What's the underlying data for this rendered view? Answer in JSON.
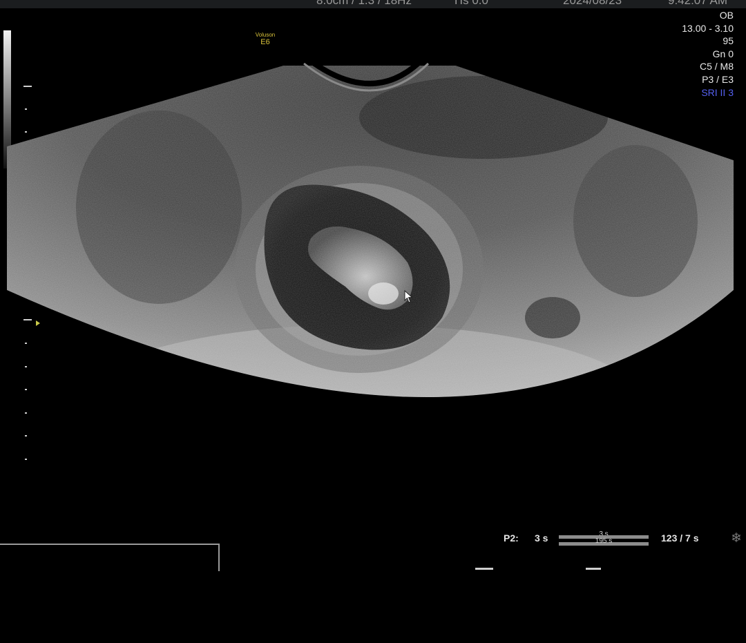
{
  "header": {
    "probe_info": "8.0cm / 1.3 / 18Hz",
    "tis": "TIs 0.0",
    "date": "2024/08/23",
    "time": "9:42:07 AM"
  },
  "brand": {
    "line1": "Voluson",
    "line2": "E6"
  },
  "params": {
    "mode": "OB",
    "freq": "13.00 - 3.10",
    "power": "95",
    "gain": "Gn  0",
    "c_m": "C5 / M8",
    "p_e": "P3 / E3",
    "sri": "SRI II 3"
  },
  "cine": {
    "label": "P2:",
    "duration": "3 s",
    "bar_top": "3 s",
    "bar_bottom": "195 s",
    "frames": "123 / 7 s"
  },
  "icons": {
    "freeze": "snowflake-icon",
    "cursor": "arrow-cursor-icon"
  },
  "colors": {
    "brand": "#d8c23a",
    "sri": "#5560f0",
    "background": "#000000"
  }
}
